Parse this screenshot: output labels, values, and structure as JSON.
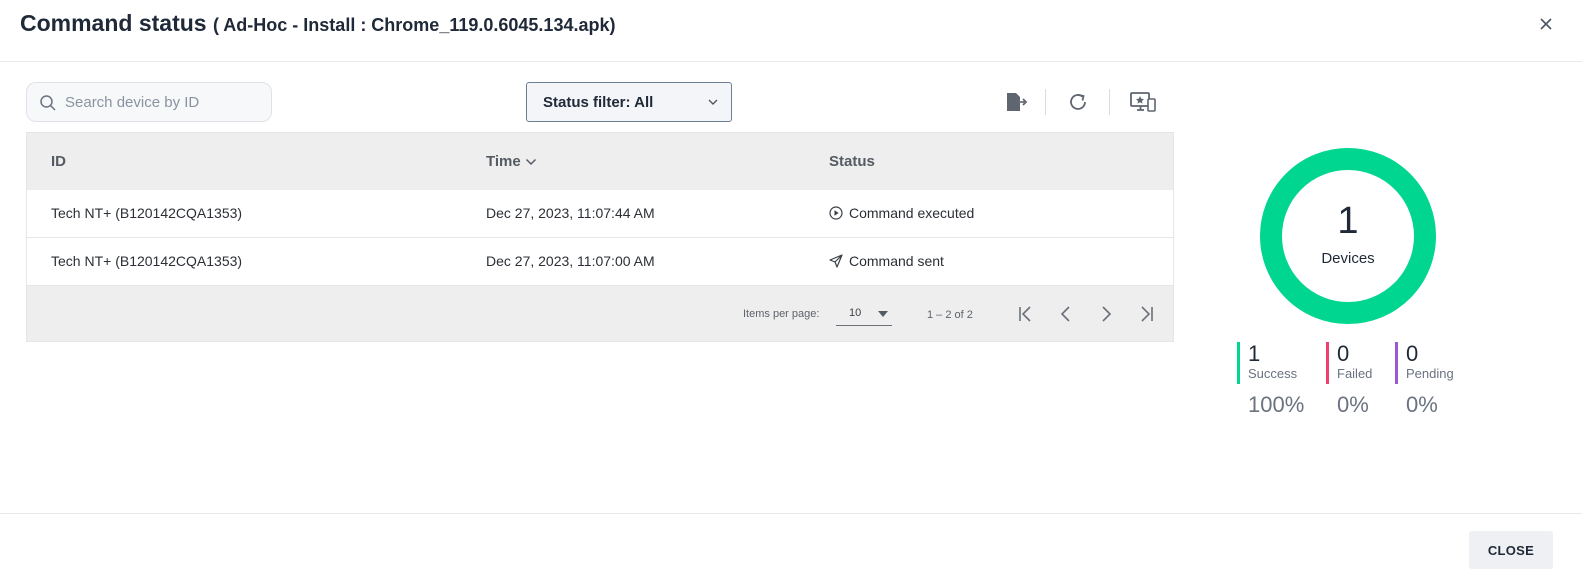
{
  "dialog": {
    "title": "Command status",
    "subtitle": "( Ad-Hoc - Install : Chrome_119.0.6045.134.apk)"
  },
  "search": {
    "placeholder": "Search device by ID",
    "value": ""
  },
  "status_filter": {
    "label": "Status filter: All"
  },
  "table": {
    "columns": [
      "ID",
      "Time",
      "Status"
    ],
    "rows": [
      {
        "id": "Tech NT+ (B120142CQA1353)",
        "time": "Dec 27, 2023, 11:07:44 AM",
        "status": "Command executed",
        "status_icon": "play-circle-icon"
      },
      {
        "id": "Tech NT+ (B120142CQA1353)",
        "time": "Dec 27, 2023, 11:07:00 AM",
        "status": "Command sent",
        "status_icon": "paper-plane-icon"
      }
    ]
  },
  "pagination": {
    "items_per_page_label": "Items per page:",
    "items_per_page": "10",
    "range": "1 – 2 of 2"
  },
  "summary": {
    "total": "1",
    "total_label": "Devices",
    "success": {
      "count": "1",
      "label": "Success",
      "percent": "100%",
      "color": "#00d68f"
    },
    "failed": {
      "count": "0",
      "label": "Failed",
      "percent": "0%",
      "color": "#ee3e6a"
    },
    "pending": {
      "count": "0",
      "label": "Pending",
      "percent": "0%",
      "color": "#9b59d0"
    }
  },
  "footer": {
    "close_label": "CLOSE"
  },
  "icons": [
    "close-icon",
    "search-icon",
    "chevron-down-icon",
    "export-icon",
    "refresh-icon",
    "remote-screen-icon",
    "sort-down-icon",
    "first-page-icon",
    "prev-page-icon",
    "next-page-icon",
    "last-page-icon"
  ]
}
